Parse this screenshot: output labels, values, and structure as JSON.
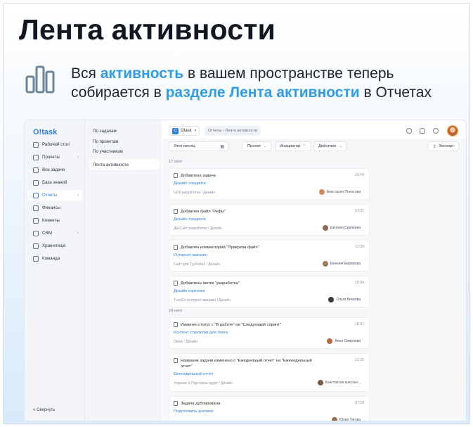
{
  "promo": {
    "headline": "Лента активности",
    "subtitle_parts": [
      "Вся ",
      "активность",
      " в вашем пространстве теперь",
      "собирается в ",
      "разделе Лента активности",
      " в Отчетах"
    ]
  },
  "app": {
    "logo": "O!task",
    "nav": [
      {
        "label": "Рабочий стол",
        "icon": "home-icon"
      },
      {
        "label": "Проекты",
        "icon": "briefcase-icon",
        "chevron": "›"
      },
      {
        "label": "Все задачи",
        "icon": "checklist-icon"
      },
      {
        "label": "База знаний",
        "icon": "book-icon"
      },
      {
        "label": "Отчеты",
        "icon": "chart-icon",
        "chevron": "›"
      },
      {
        "label": "Финансы",
        "icon": "wallet-icon"
      },
      {
        "label": "Клиенты",
        "icon": "clients-icon"
      },
      {
        "label": "CRM",
        "icon": "crm-icon",
        "chevron": "›"
      },
      {
        "label": "Хранилище",
        "icon": "folder-icon"
      },
      {
        "label": "Команда",
        "icon": "team-icon"
      }
    ],
    "collapse_label": "«  Свернуть",
    "subnav": [
      "По задачам",
      "По проектам",
      "По участникам",
      "Лента активности"
    ],
    "topbar": {
      "workspace": "Otask",
      "workspace_badge": "O",
      "crumbs": "Отчеты  ›  Лента активности"
    },
    "filters": {
      "period": "Этот месяц",
      "project": "Проект",
      "initiator": "Инициатор",
      "action": "Действие",
      "export": "Экспорт"
    },
    "groups": [
      {
        "date": "17 сент",
        "cards": [
          {
            "title": "Добавлена задача",
            "time": "20:04",
            "link": "Дизайн лэндинга",
            "path": "ЦОК разработка  /  Дизайн",
            "user": "Анастасия Поносова",
            "avatar_color": "#c98a5e"
          },
          {
            "title": "Добавлен файл \"Рефы\"",
            "time": "13:31",
            "link": "Дизайн лэндинга",
            "path": "ДизСайт разработка  /  Дизайн",
            "user": "Евгения Серпеева",
            "avatar_color": "#8b6b52"
          },
          {
            "title": "Добавлен комментарий \"Прикрепи файл\"",
            "time": "12:39",
            "link": "Интернет магазин",
            "path": "Сайт для ТурбоКаб  /  Дизайн",
            "user": "Евгения Евремова",
            "avatar_color": "#a07a5c"
          },
          {
            "title": "Добавлены метки \"разработка\"",
            "time": "10:04",
            "link": "Дизайн карточки",
            "path": "ТсеаGo интернет-магазин  /  Дизайн",
            "user": "Ольга Велкова",
            "avatar_color": "#3d3a3a"
          }
        ]
      },
      {
        "date": "16 сент",
        "cards": [
          {
            "title": "Изменен статус с \"В работе\" на \"Следующий спринт\"",
            "time": "16:01",
            "link": "Контент стратегия для блога",
            "path": "Otask  /  Дизайн",
            "user": "Анна Смирнова",
            "avatar_color": "#b86a3a"
          },
          {
            "title": "Название задачи изменено с \"Ежедневный отчет\" на \"Еженедельный отчет\"",
            "time": "21:25",
            "link": "Еженедельный отчёт",
            "path": "Уеркали & Партнеры аудит  /  Дизайн",
            "user": "Константин констан...",
            "avatar_color": "#7a5a46"
          },
          {
            "title": "Задача дублирована",
            "time": "07:24",
            "link": "Подготовить договор",
            "path": "",
            "user": "Юлия Тягова",
            "avatar_color": "#9a6b4a"
          }
        ]
      }
    ]
  },
  "colors": {
    "accent": "#2f9ce6",
    "brand": "#2f7fe0"
  }
}
